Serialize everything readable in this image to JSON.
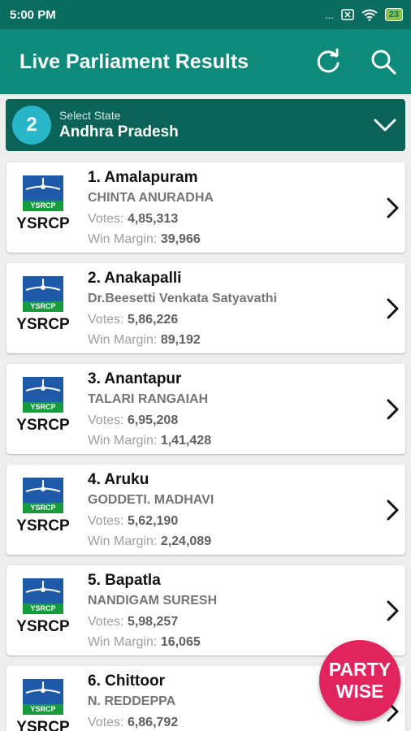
{
  "status_bar": {
    "time": "5:00 PM",
    "more": "...",
    "battery": "23"
  },
  "app_bar": {
    "title": "Live Parliament Results"
  },
  "state_selector": {
    "badge": "2",
    "caption": "Select State",
    "value": "Andhra Pradesh"
  },
  "labels": {
    "votes": "Votes:",
    "win_margin": "Win Margin:"
  },
  "results": [
    {
      "constituency": "1. Amalapuram",
      "candidate": "CHINTA ANURADHA",
      "votes": "4,85,313",
      "margin": "39,966",
      "party": "YSRCP",
      "flag_text": "YSRCP"
    },
    {
      "constituency": "2. Anakapalli",
      "candidate": "Dr.Beesetti Venkata Satyavathi",
      "votes": "5,86,226",
      "margin": "89,192",
      "party": "YSRCP",
      "flag_text": "YSRCP"
    },
    {
      "constituency": "3. Anantapur",
      "candidate": "TALARI RANGAIAH",
      "votes": "6,95,208",
      "margin": "1,41,428",
      "party": "YSRCP",
      "flag_text": "YSRCP"
    },
    {
      "constituency": "4. Aruku",
      "candidate": "GODDETI. MADHAVI",
      "votes": "5,62,190",
      "margin": "2,24,089",
      "party": "YSRCP",
      "flag_text": "YSRCP"
    },
    {
      "constituency": "5. Bapatla",
      "candidate": "NANDIGAM SURESH",
      "votes": "5,98,257",
      "margin": "16,065",
      "party": "YSRCP",
      "flag_text": "YSRCP"
    },
    {
      "constituency": "6. Chittoor",
      "candidate": "N. REDDEPPA",
      "votes": "6,86,792",
      "margin": "",
      "party": "YSRCP",
      "flag_text": "YSRCP"
    }
  ],
  "fab": {
    "line1": "PARTY",
    "line2": "WISE"
  },
  "colors": {
    "status_bar": "#0b6d5f",
    "app_bar": "#0d8a79",
    "state_bar": "#0b6358",
    "badge": "#27b7c9",
    "fab": "#e1245d",
    "flag_blue": "#1e5aa8",
    "flag_green": "#169c3a"
  },
  "icons": [
    "refresh-icon",
    "search-icon",
    "chevron-down-icon",
    "chevron-right-icon",
    "wifi-icon",
    "sim-icon"
  ]
}
